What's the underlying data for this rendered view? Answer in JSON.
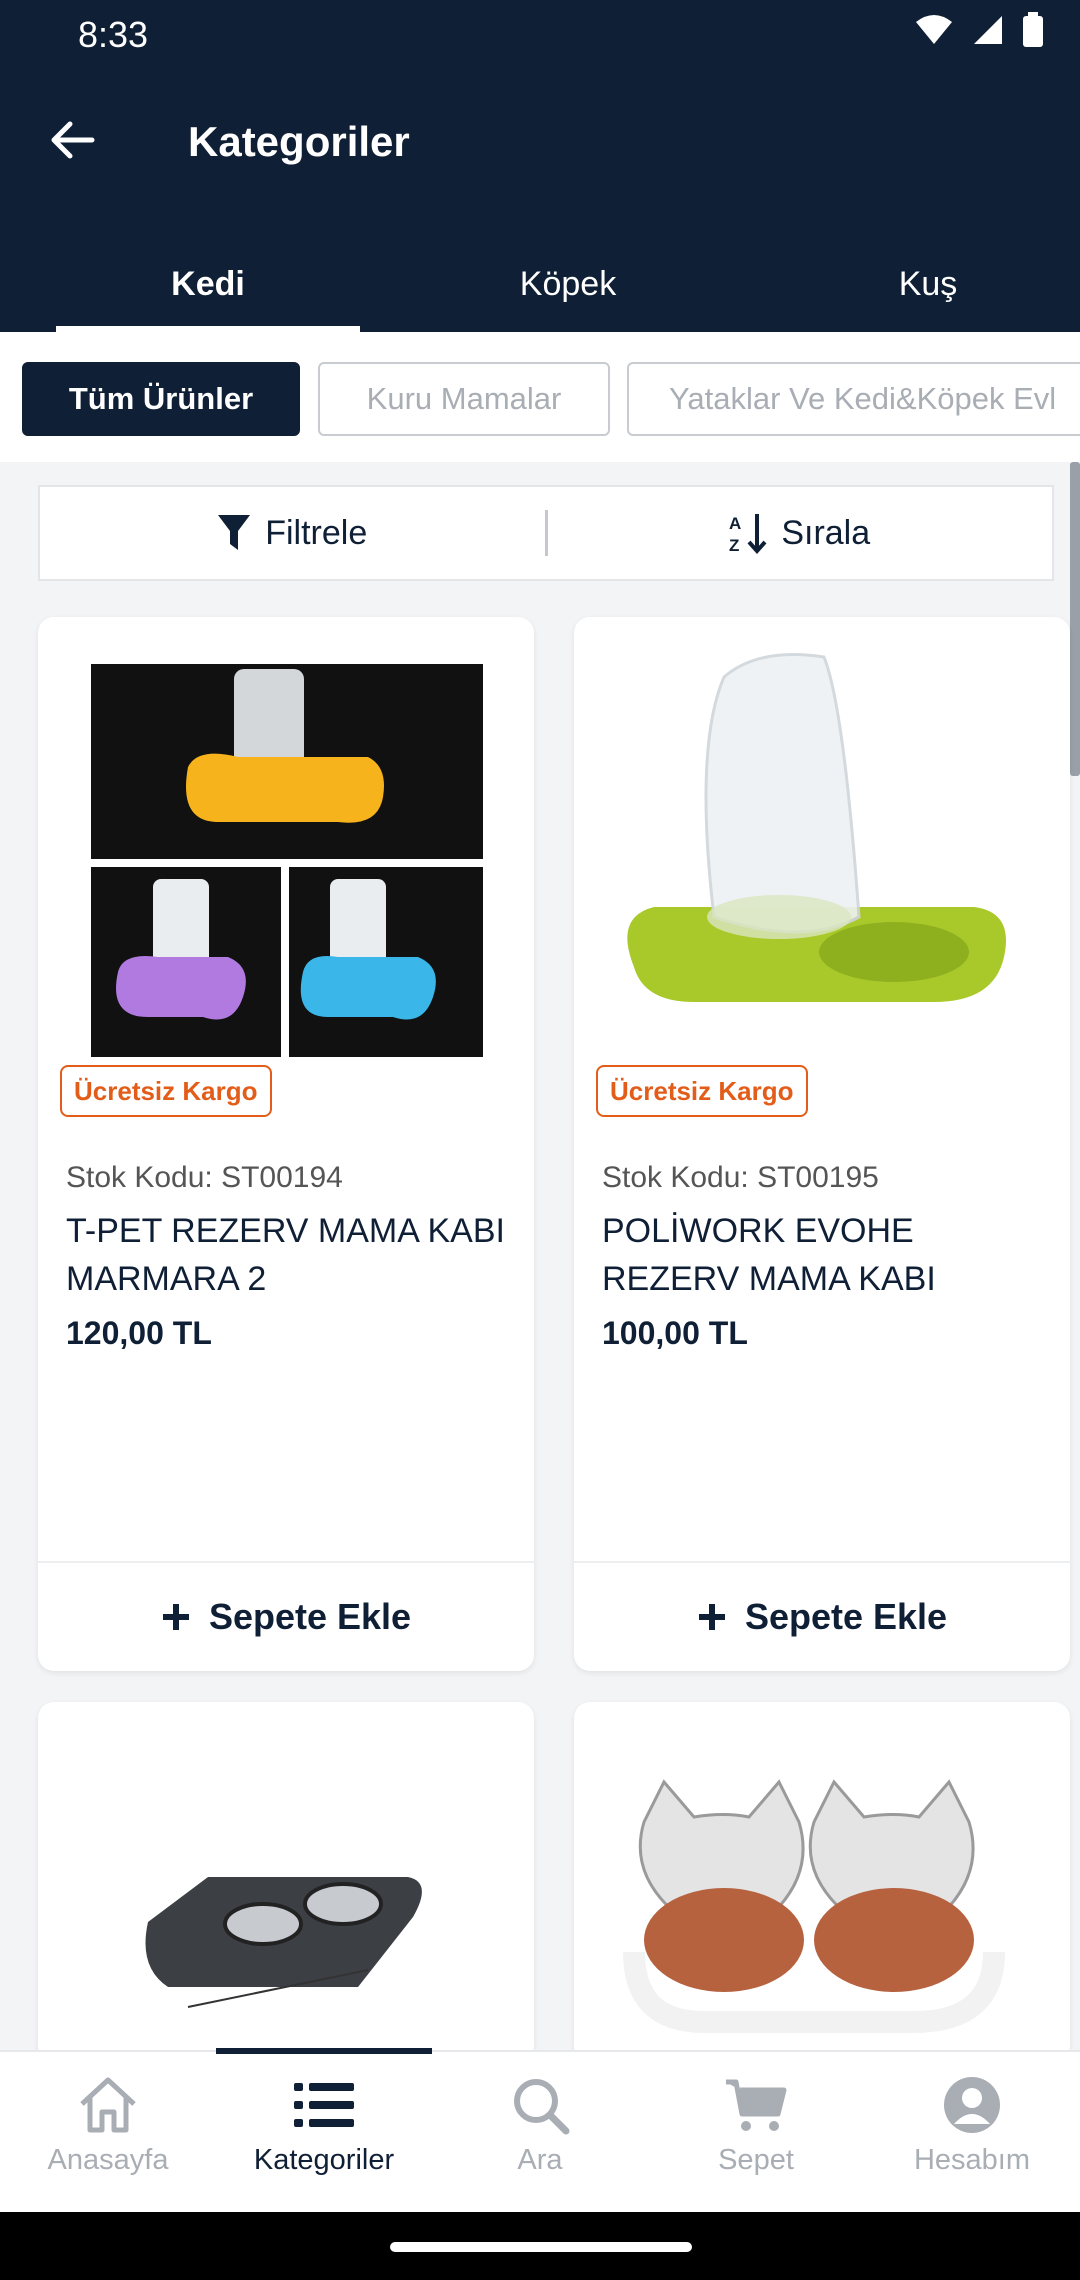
{
  "status_bar": {
    "time": "8:33"
  },
  "header": {
    "title": "Kategoriler"
  },
  "tabs": [
    {
      "label": "Kedi",
      "active": true
    },
    {
      "label": "Köpek",
      "active": false
    },
    {
      "label": "Kuş",
      "active": false
    }
  ],
  "subcategories": [
    {
      "label": "Tüm Ürünler",
      "active": true
    },
    {
      "label": "Kuru Mamalar",
      "active": false
    },
    {
      "label": "Yataklar Ve Kedi&Köpek Evl",
      "active": false
    }
  ],
  "toolbar": {
    "filter_label": "Filtrele",
    "sort_label": "Sırala"
  },
  "products": [
    {
      "badge": "Ücretsiz Kargo",
      "stock": "Stok Kodu: ST00194",
      "name": "T-PET REZERV MAMA KABI MARMARA 2",
      "price": "120,00 TL",
      "add_label": "Sepete Ekle"
    },
    {
      "badge": "Ücretsiz Kargo",
      "stock": "Stok Kodu: ST00195",
      "name": "POLİWORK EVOHE REZERV MAMA KABI",
      "price": "100,00 TL",
      "add_label": "Sepete Ekle"
    }
  ],
  "bottom_nav": [
    {
      "label": "Anasayfa",
      "icon": "home-icon",
      "active": false
    },
    {
      "label": "Kategoriler",
      "icon": "list-icon",
      "active": true
    },
    {
      "label": "Ara",
      "icon": "search-icon",
      "active": false
    },
    {
      "label": "Sepet",
      "icon": "cart-icon",
      "active": false
    },
    {
      "label": "Hesabım",
      "icon": "account-icon",
      "active": false
    }
  ],
  "colors": {
    "primary": "#0f1f35",
    "badge": "#e35d1a",
    "inactive": "#a9adb4"
  }
}
